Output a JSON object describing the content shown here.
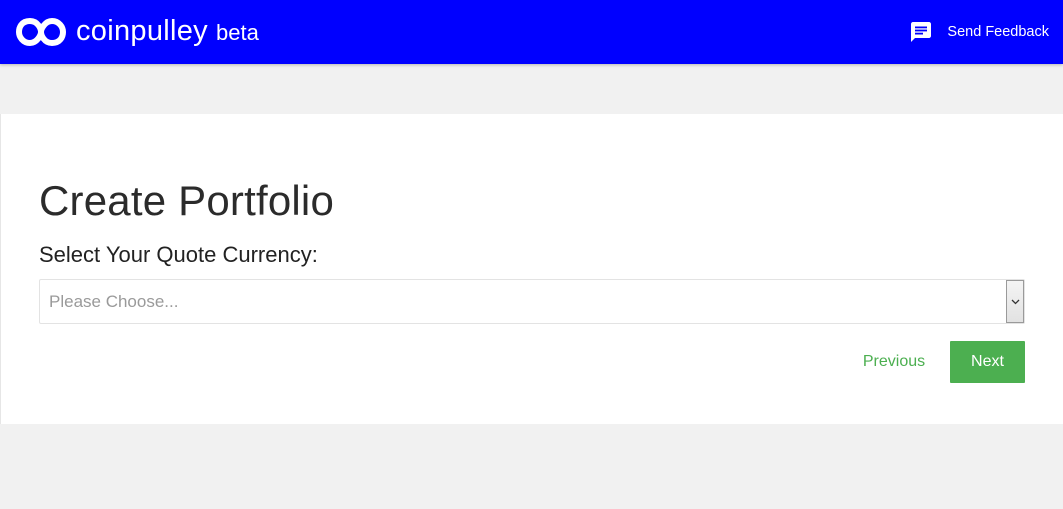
{
  "app": {
    "brand_name": "coinpulley",
    "brand_badge": "beta",
    "logo_icon": "infinity-icon"
  },
  "header": {
    "feedback_label": "Send Feedback",
    "feedback_icon": "chat-icon",
    "background_color": "#0000ff"
  },
  "main": {
    "title": "Create Portfolio",
    "currency_label": "Select Your Quote Currency:",
    "currency_select": {
      "selected_value": "Please Choose...",
      "arrow_icon": "chevron-down-icon"
    },
    "actions": {
      "previous_label": "Previous",
      "next_label": "Next",
      "accent_color": "#4caf50"
    }
  }
}
